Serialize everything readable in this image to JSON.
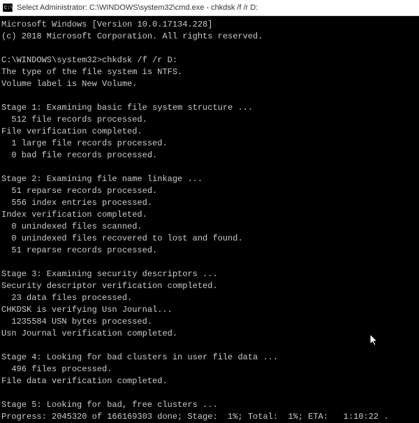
{
  "titlebar": {
    "text": "Select Administrator: C:\\WINDOWS\\system32\\cmd.exe - chkdsk  /f /r D:"
  },
  "terminal": {
    "version_line": "Microsoft Windows [Version 10.0.17134.228]",
    "copyright_line": "(c) 2018 Microsoft Corporation. All rights reserved.",
    "prompt_line": "C:\\WINDOWS\\system32>chkdsk /f /r D:",
    "fs_type_line": "The type of the file system is NTFS.",
    "volume_label_line": "Volume label is New Volume.",
    "stage1_header": "Stage 1: Examining basic file system structure ...",
    "stage1_records": "  512 file records processed.",
    "stage1_verify": "File verification completed.",
    "stage1_large": "  1 large file records processed.",
    "stage1_bad": "  0 bad file records processed.",
    "stage2_header": "Stage 2: Examining file name linkage ...",
    "stage2_reparse1": "  51 reparse records processed.",
    "stage2_index": "  556 index entries processed.",
    "stage2_verify": "Index verification completed.",
    "stage2_unindexed_scan": "  0 unindexed files scanned.",
    "stage2_unindexed_recov": "  0 unindexed files recovered to lost and found.",
    "stage2_reparse2": "  51 reparse records processed.",
    "stage3_header": "Stage 3: Examining security descriptors ...",
    "stage3_verify": "Security descriptor verification completed.",
    "stage3_data": "  23 data files processed.",
    "stage3_usn_verifying": "CHKDSK is verifying Usn Journal...",
    "stage3_usn_bytes": "  1235584 USN bytes processed.",
    "stage3_usn_verify": "Usn Journal verification completed.",
    "stage4_header": "Stage 4: Looking for bad clusters in user file data ...",
    "stage4_files": "  496 files processed.",
    "stage4_verify": "File data verification completed.",
    "stage5_header": "Stage 5: Looking for bad, free clusters ...",
    "stage5_progress": "Progress: 2045320 of 166169303 done; Stage:  1%; Total:  1%; ETA:   1:10:22 ."
  }
}
